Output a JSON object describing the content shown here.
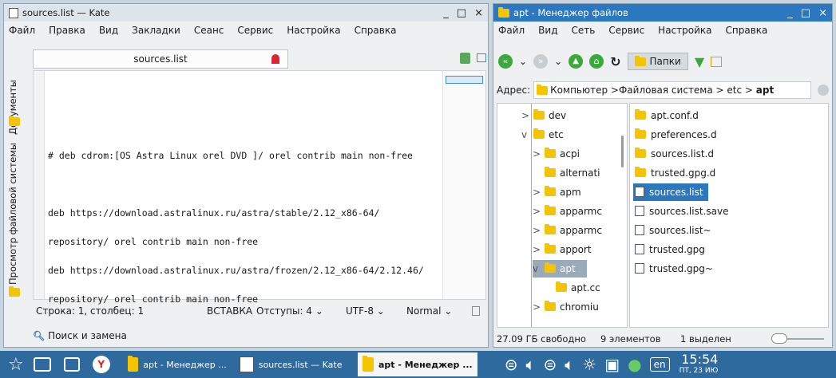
{
  "kate": {
    "title": "sources.list — Kate",
    "window_buttons": [
      "_",
      "□",
      "×"
    ],
    "menu": [
      "Файл",
      "Правка",
      "Вид",
      "Закладки",
      "Сеанс",
      "Сервис",
      "Настройка",
      "Справка"
    ],
    "tab_label": "sources.list",
    "side_tabs": [
      "Документы",
      "Просмотр файловой системы"
    ],
    "editor_lines": [
      "",
      "",
      "# deb cdrom:[OS Astra Linux orel DVD ]/ orel contrib main non-free",
      "",
      "deb https://download.astralinux.ru/astra/stable/2.12_x86-64/",
      "repository/ orel contrib main non-free",
      "deb https://download.astralinux.ru/astra/frozen/2.12_x86-64/2.12.46/",
      "repository/ orel contrib main non-free"
    ],
    "status": {
      "position": "Строка: 1, столбец: 1",
      "mode": "ВСТАВКА",
      "indent": "Отступы: 4",
      "encoding": "UTF-8",
      "highlight": "Normal"
    },
    "search_label": "Поиск и замена"
  },
  "fm": {
    "title": "apt - Менеджер файлов",
    "window_buttons": [
      "_",
      "□",
      "×"
    ],
    "menu": [
      "Файл",
      "Вид",
      "Сеть",
      "Сервис",
      "Настройка",
      "Справка"
    ],
    "folders_button": "Папки",
    "address_label": "Адрес:",
    "breadcrumb": [
      "Компьютер",
      "Файловая система",
      "etc",
      "apt"
    ],
    "tree": [
      {
        "label": "dev",
        "depth": 1,
        "arrow": ">"
      },
      {
        "label": "etc",
        "depth": 1,
        "arrow": "v"
      },
      {
        "label": "acpi",
        "depth": 2,
        "arrow": ">"
      },
      {
        "label": "alternati",
        "depth": 2,
        "arrow": ""
      },
      {
        "label": "apm",
        "depth": 2,
        "arrow": ">"
      },
      {
        "label": "apparmc",
        "depth": 2,
        "arrow": ">"
      },
      {
        "label": "apparmc",
        "depth": 2,
        "arrow": ">"
      },
      {
        "label": "apport",
        "depth": 2,
        "arrow": ">"
      },
      {
        "label": "apt",
        "depth": 2,
        "arrow": "v"
      },
      {
        "label": "apt.cc",
        "depth": 3,
        "arrow": ""
      },
      {
        "label": "chromiu",
        "depth": 2,
        "arrow": ">"
      }
    ],
    "files": [
      {
        "name": "apt.conf.d",
        "type": "folder"
      },
      {
        "name": "preferences.d",
        "type": "folder"
      },
      {
        "name": "sources.list.d",
        "type": "folder"
      },
      {
        "name": "trusted.gpg.d",
        "type": "folder"
      },
      {
        "name": "sources.list",
        "type": "file"
      },
      {
        "name": "sources.list.save",
        "type": "file"
      },
      {
        "name": "sources.list~",
        "type": "file"
      },
      {
        "name": "trusted.gpg",
        "type": "file"
      },
      {
        "name": "trusted.gpg~",
        "type": "file"
      }
    ],
    "status": {
      "free": "27.09 ГБ свободно",
      "count": "9 элементов",
      "selected": "1 выделен"
    }
  },
  "taskbar": {
    "items": [
      "apt - Менеджер ...",
      "sources.list — Kate",
      "apt - Менеджер ..."
    ],
    "lang": "en",
    "time": "15:54",
    "date": "ПТ, 23 ИЮ"
  }
}
